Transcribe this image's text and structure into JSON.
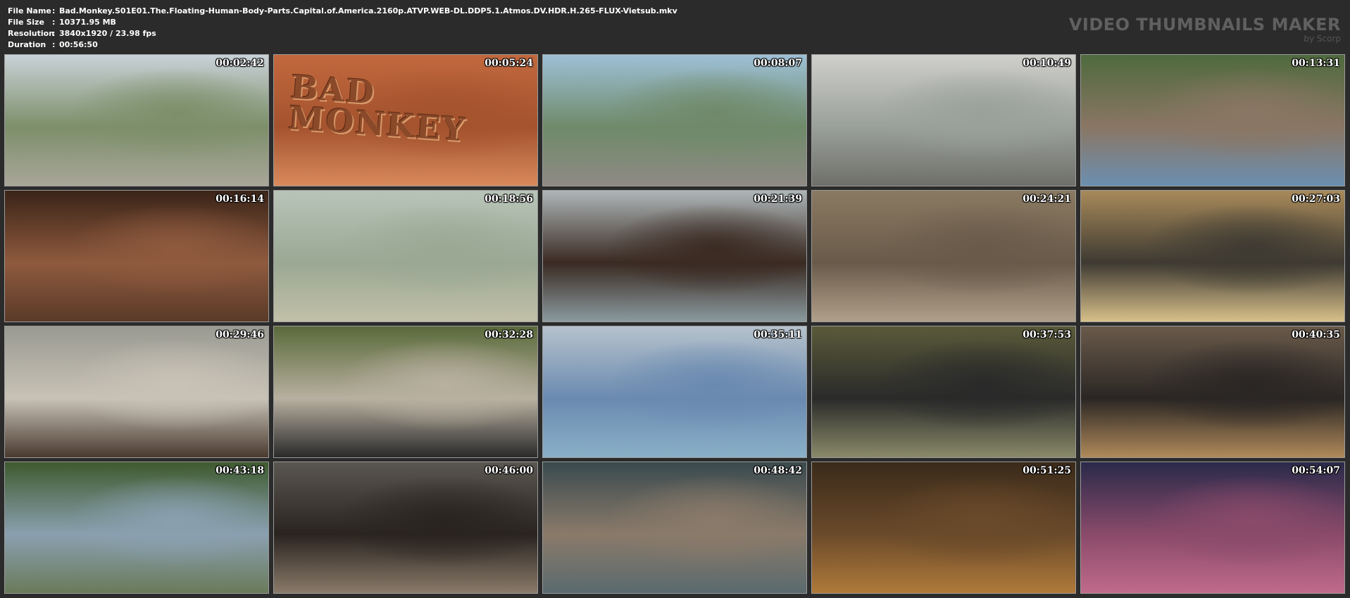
{
  "header": {
    "file_name_label": "File Name",
    "file_name_value": "Bad.Monkey.S01E01.The.Floating-Human-Body-Parts.Capital.of.America.2160p.ATVP.WEB-DL.DDP5.1.Atmos.DV.HDR.H.265-FLUX-Vietsub.mkv",
    "file_size_label": "File Size",
    "file_size_value": "10371.95 MB",
    "resolution_label": "Resolution",
    "resolution_value": "3840x1920 / 23.98 fps",
    "duration_label": "Duration",
    "duration_value": "00:56:50",
    "separator": ":"
  },
  "brand": {
    "title": "VIDEO THUMBNAILS MAKER",
    "subtitle": "by Scorp"
  },
  "thumbnails": [
    {
      "time": "00:02:42",
      "scene": "beach-fence-icon",
      "colors": [
        "#c9d2d8",
        "#7d8f6a",
        "#a9a69a"
      ]
    },
    {
      "time": "00:05:24",
      "scene": "sand-title-image",
      "colors": [
        "#c2683e",
        "#a4532e",
        "#d98a5c"
      ],
      "text_line1": "BAD",
      "text_line2": "MONKEY"
    },
    {
      "time": "00:08:07",
      "scene": "street-man-icon",
      "colors": [
        "#9ec0d6",
        "#6f8a6a",
        "#8f8a84"
      ]
    },
    {
      "time": "00:10:49",
      "scene": "kitchen-scene-icon",
      "colors": [
        "#cfcfcb",
        "#9aa09a",
        "#6f6f6a"
      ]
    },
    {
      "time": "00:13:31",
      "scene": "closeup-man-icon",
      "colors": [
        "#4f6a3e",
        "#8a7664",
        "#6b8fb0"
      ]
    },
    {
      "time": "00:16:14",
      "scene": "closeup-woman-icon",
      "colors": [
        "#3a2418",
        "#8f5a3e",
        "#5a3a28"
      ]
    },
    {
      "time": "00:18:56",
      "scene": "beach-birds-icon",
      "colors": [
        "#b8c4b8",
        "#9aa894",
        "#c2c0a8"
      ]
    },
    {
      "time": "00:21:39",
      "scene": "closeup-boy-icon",
      "colors": [
        "#aeb6b8",
        "#3a2a22",
        "#8a9a9e"
      ]
    },
    {
      "time": "00:24:21",
      "scene": "seated-man-icon",
      "colors": [
        "#8a7a62",
        "#6a5a4a",
        "#b0a08a"
      ]
    },
    {
      "time": "00:27:03",
      "scene": "car-woman-icon",
      "colors": [
        "#a88a5a",
        "#3e3a32",
        "#d8c08a"
      ]
    },
    {
      "time": "00:29:46",
      "scene": "doctor-woman-icon",
      "colors": [
        "#9a9a92",
        "#c8c2b6",
        "#4a3a30"
      ]
    },
    {
      "time": "00:32:28",
      "scene": "outdoor-boy-icon",
      "colors": [
        "#5a6a3a",
        "#b8b0a0",
        "#2a2a2a"
      ]
    },
    {
      "time": "00:35:11",
      "scene": "porch-man-icon",
      "colors": [
        "#b6c2cc",
        "#6a8ab0",
        "#8ab0c8"
      ]
    },
    {
      "time": "00:37:53",
      "scene": "suits-men-icon",
      "colors": [
        "#5a5a3a",
        "#2a2a2a",
        "#8a8a6a"
      ]
    },
    {
      "time": "00:40:35",
      "scene": "bar-man-icon",
      "colors": [
        "#6a5a4a",
        "#2a2624",
        "#b08a5a"
      ]
    },
    {
      "time": "00:43:18",
      "scene": "garden-man-icon",
      "colors": [
        "#3e5a2e",
        "#8aa0b0",
        "#6a7a5a"
      ]
    },
    {
      "time": "00:46:00",
      "scene": "closeup-dark-boy-icon",
      "colors": [
        "#5a5650",
        "#2a2420",
        "#8a7a6a"
      ]
    },
    {
      "time": "00:48:42",
      "scene": "closeup-man-talk-icon",
      "colors": [
        "#3a4a4e",
        "#8a7a6a",
        "#5a6a6e"
      ]
    },
    {
      "time": "00:51:25",
      "scene": "candle-room-icon",
      "colors": [
        "#3a2a1a",
        "#6a4a2a",
        "#b07a3a"
      ]
    },
    {
      "time": "00:54:07",
      "scene": "night-man-icon",
      "colors": [
        "#2a2a4a",
        "#8a4a6a",
        "#c06a8a"
      ]
    }
  ]
}
